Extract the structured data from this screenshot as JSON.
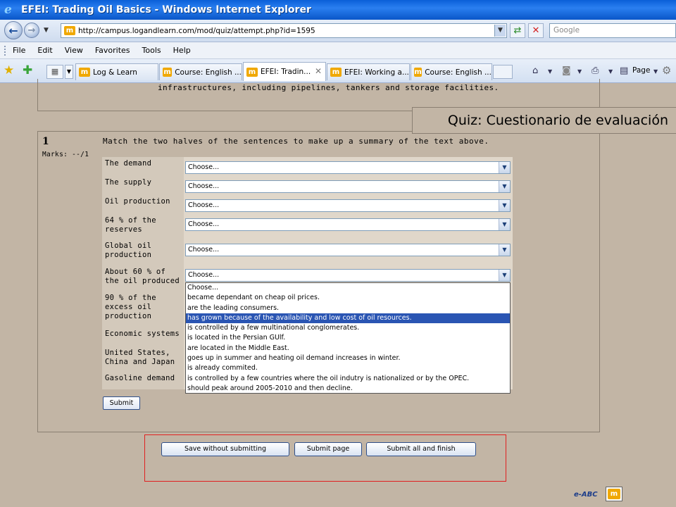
{
  "browser": {
    "window_title": "EFEI: Trading Oil Basics - Windows Internet Explorer",
    "address": "http://campus.logandlearn.com/mod/quiz/attempt.php?id=1595",
    "search_placeholder": "Google",
    "menus": [
      "File",
      "Edit",
      "View",
      "Favorites",
      "Tools",
      "Help"
    ],
    "tabs": [
      {
        "label": "Log & Learn",
        "active": false
      },
      {
        "label": "Course: English ...",
        "active": false
      },
      {
        "label": "EFEI: Tradin...",
        "active": true
      },
      {
        "label": "EFEI: Working a...",
        "active": false
      },
      {
        "label": "Course: English ...",
        "active": false
      }
    ],
    "page_menu": "Page",
    "favicon_text": "m"
  },
  "content": {
    "previous_text": "infrastructures, including pipelines, tankers and storage facilities.",
    "quiz_label": "Quiz: Cuestionario de evaluación",
    "question": {
      "number": "1",
      "marks": "Marks: --/1",
      "instruction": "Match the two halves of the sentences to make up a summary of the text above."
    },
    "rows": [
      {
        "label": "The demand",
        "value": "Choose..."
      },
      {
        "label": "The supply",
        "value": "Choose..."
      },
      {
        "label": "Oil production",
        "value": "Choose..."
      },
      {
        "label": "64 % of the reserves",
        "value": "Choose..."
      },
      {
        "label": "Global oil production",
        "value": "Choose..."
      },
      {
        "label": "About 60 % of the oil produced",
        "value": "Choose..."
      },
      {
        "label": "90 % of the excess oil production",
        "value": "Choose..."
      },
      {
        "label": "Economic systems",
        "value": "Choose..."
      },
      {
        "label": "United States, China and Japan",
        "value": "Choose..."
      },
      {
        "label": "Gasoline demand",
        "value": "Choose..."
      }
    ],
    "dropdown_options": [
      "Choose...",
      "became dependant on cheap oil prices.",
      "are the leading consumers.",
      "has grown because of the availability and low cost of oil resources.",
      "is controlled by a few multinational conglomerates.",
      "is located in the Persian GUlf.",
      "are located in the Middle East.",
      "goes up in summer and heating oil demand increases in winter.",
      "is already commited.",
      "is controlled by a few countries where the oil indutry is nationalized or by the OPEC.",
      "should peak around 2005-2010 and then decline."
    ],
    "dropdown_selected_index": 3,
    "submit_label": "Submit",
    "buttons": {
      "save": "Save without submitting",
      "submit_page": "Submit page",
      "submit_finish": "Submit all and finish"
    },
    "footer_brand": "e-ABC"
  }
}
